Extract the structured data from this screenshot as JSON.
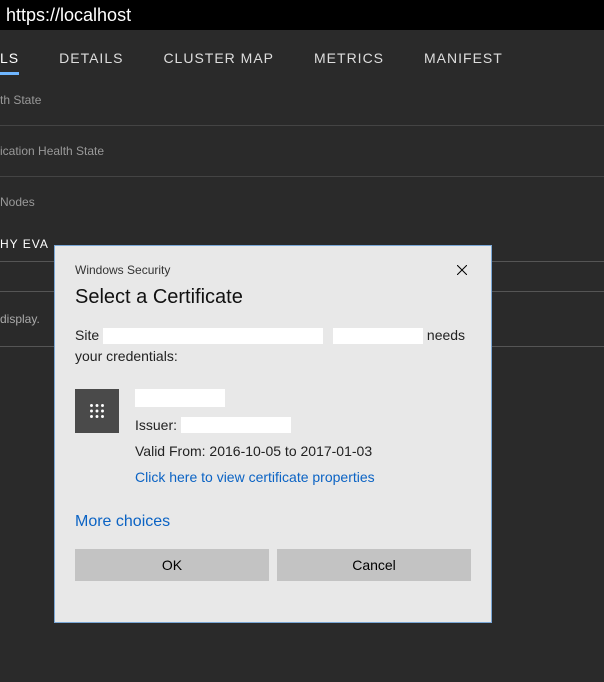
{
  "address": "https://localhost",
  "tabs": [
    "LS",
    "DETAILS",
    "CLUSTER MAP",
    "METRICS",
    "MANIFEST"
  ],
  "activeTab": 0,
  "sideLabels": [
    "th State",
    "ication Health State",
    "Nodes"
  ],
  "sectionHeader": "HY EVA",
  "displayLabel": "display.",
  "dialog": {
    "header": "Windows Security",
    "title": "Select a Certificate",
    "msgPrefix": "Site ",
    "msgSuffix": " needs your credentials:",
    "issuerLabel": "Issuer: ",
    "validFrom": "Valid From: 2016-10-05 to 2017-01-03",
    "viewProps": "Click here to view certificate properties",
    "moreChoices": "More choices",
    "ok": "OK",
    "cancel": "Cancel"
  }
}
